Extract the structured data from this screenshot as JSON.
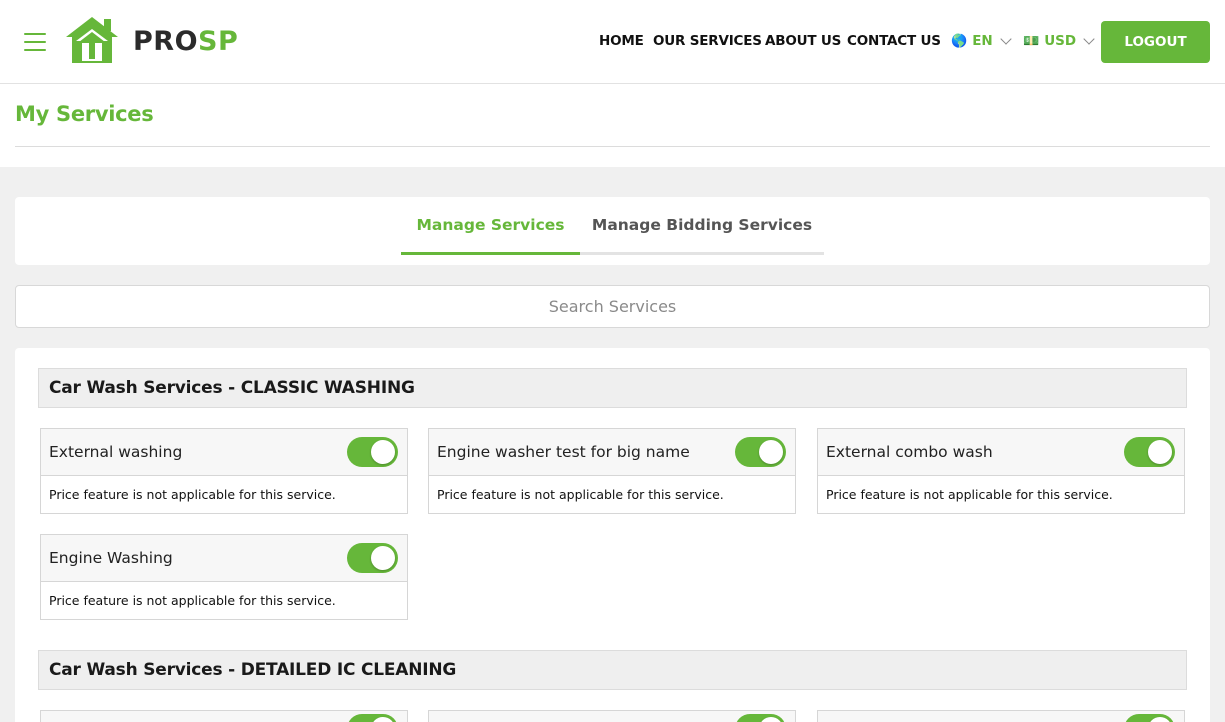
{
  "brand": {
    "name_part1": "PRO",
    "name_part2": "SP",
    "accent_color": "#66b73a"
  },
  "nav": {
    "links": [
      "HOME",
      "OUR SERVICES",
      "ABOUT US",
      "CONTACT US"
    ],
    "language": {
      "flag": "🌎",
      "code": "EN"
    },
    "currency": {
      "flag": "💵",
      "code": "USD"
    },
    "logout_label": "LOGOUT"
  },
  "page": {
    "title": "My Services"
  },
  "tabs": [
    {
      "label": "Manage Services",
      "active": true
    },
    {
      "label": "Manage Bidding Services",
      "active": false
    }
  ],
  "search": {
    "placeholder": "Search Services"
  },
  "categories": [
    {
      "title": "Car Wash Services - CLASSIC WASHING",
      "services": [
        {
          "name": "External washing",
          "enabled": true,
          "note": "Price feature is not applicable for this service."
        },
        {
          "name": "Engine washer test for big name",
          "enabled": true,
          "note": "Price feature is not applicable for this service."
        },
        {
          "name": "External combo wash",
          "enabled": true,
          "note": "Price feature is not applicable for this service."
        },
        {
          "name": "Engine Washing",
          "enabled": true,
          "note": "Price feature is not applicable for this service."
        }
      ]
    },
    {
      "title": "Car Wash Services - DETAILED IC CLEANING",
      "services": []
    }
  ]
}
